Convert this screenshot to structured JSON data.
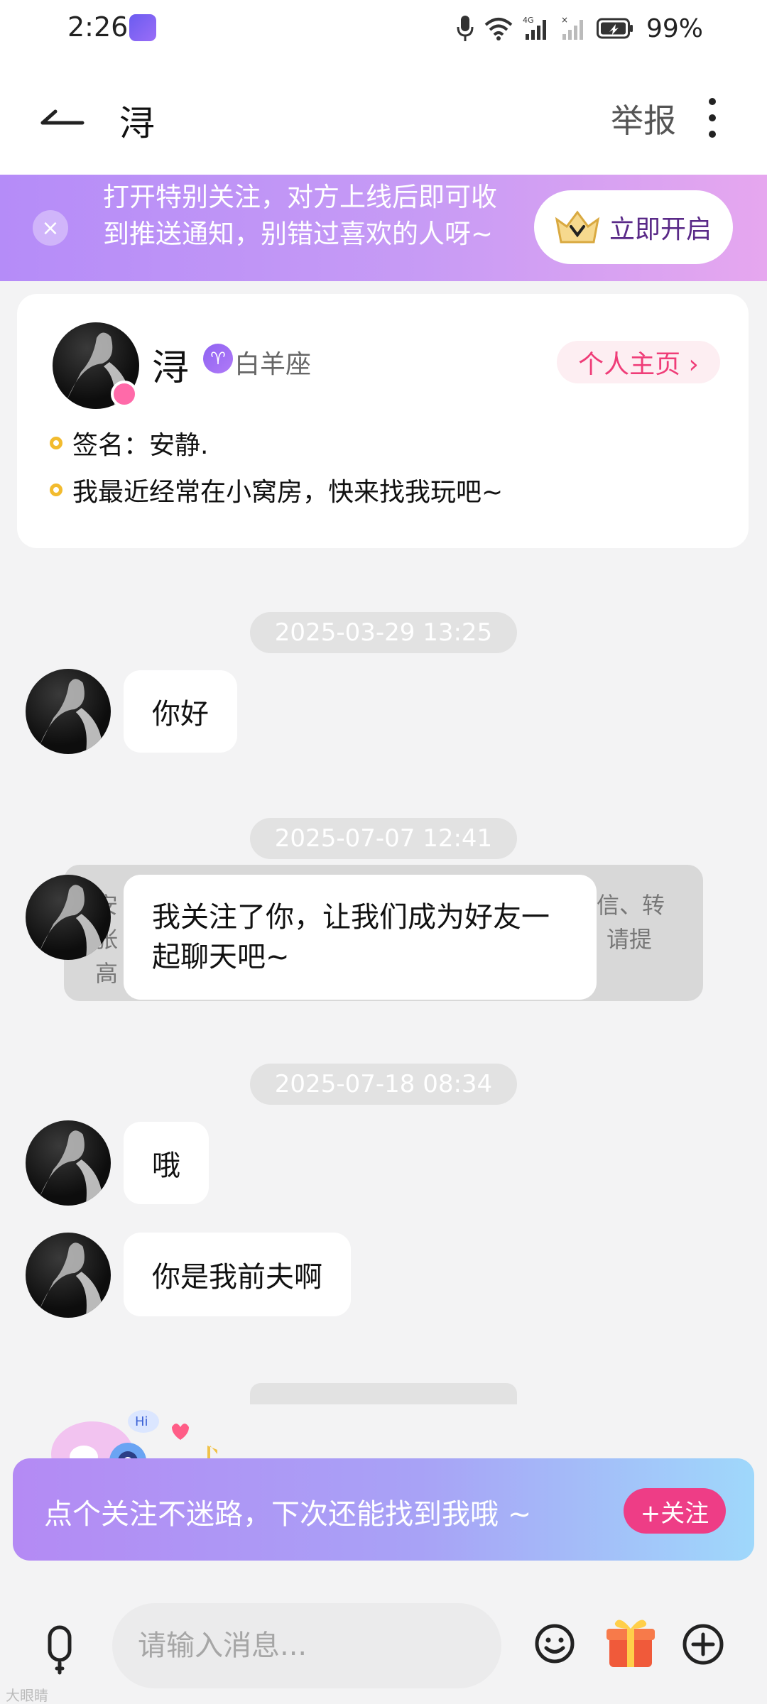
{
  "status_bar": {
    "time": "2:26",
    "battery": "99%"
  },
  "header": {
    "title": "浔",
    "report_label": "举报"
  },
  "promo": {
    "text": "打开特别关注，对方上线后即可收到推送通知，别错过喜欢的人呀~",
    "button_label": "立即开启"
  },
  "profile": {
    "name": "浔",
    "zodiac_symbol": "♈",
    "zodiac": "白羊座",
    "home_button": "个人主页 ›",
    "signature": "签名：安静.",
    "status": "我最近经常在小窝房，快来找我玩吧~"
  },
  "chat": {
    "timestamps": [
      "2025-03-29 13:25",
      "2025-07-07 12:41",
      "2025-07-18 08:34"
    ],
    "messages": [
      {
        "text": "你好"
      },
      {
        "text": "我关注了你，让我们成为好友一起聊天吧~"
      },
      {
        "text": "哦"
      },
      {
        "text": "你是我前夫啊"
      }
    ],
    "system_notice_fragments": [
      "安",
      "信、转",
      "张",
      "请提",
      "高"
    ]
  },
  "follow_banner": {
    "text": "点个关注不迷路，下次还能找到我哦 ~",
    "button_label": "+关注",
    "mascot_tag": "Hi"
  },
  "composer": {
    "placeholder": "请输入消息..."
  },
  "watermark": "大眼睛"
}
